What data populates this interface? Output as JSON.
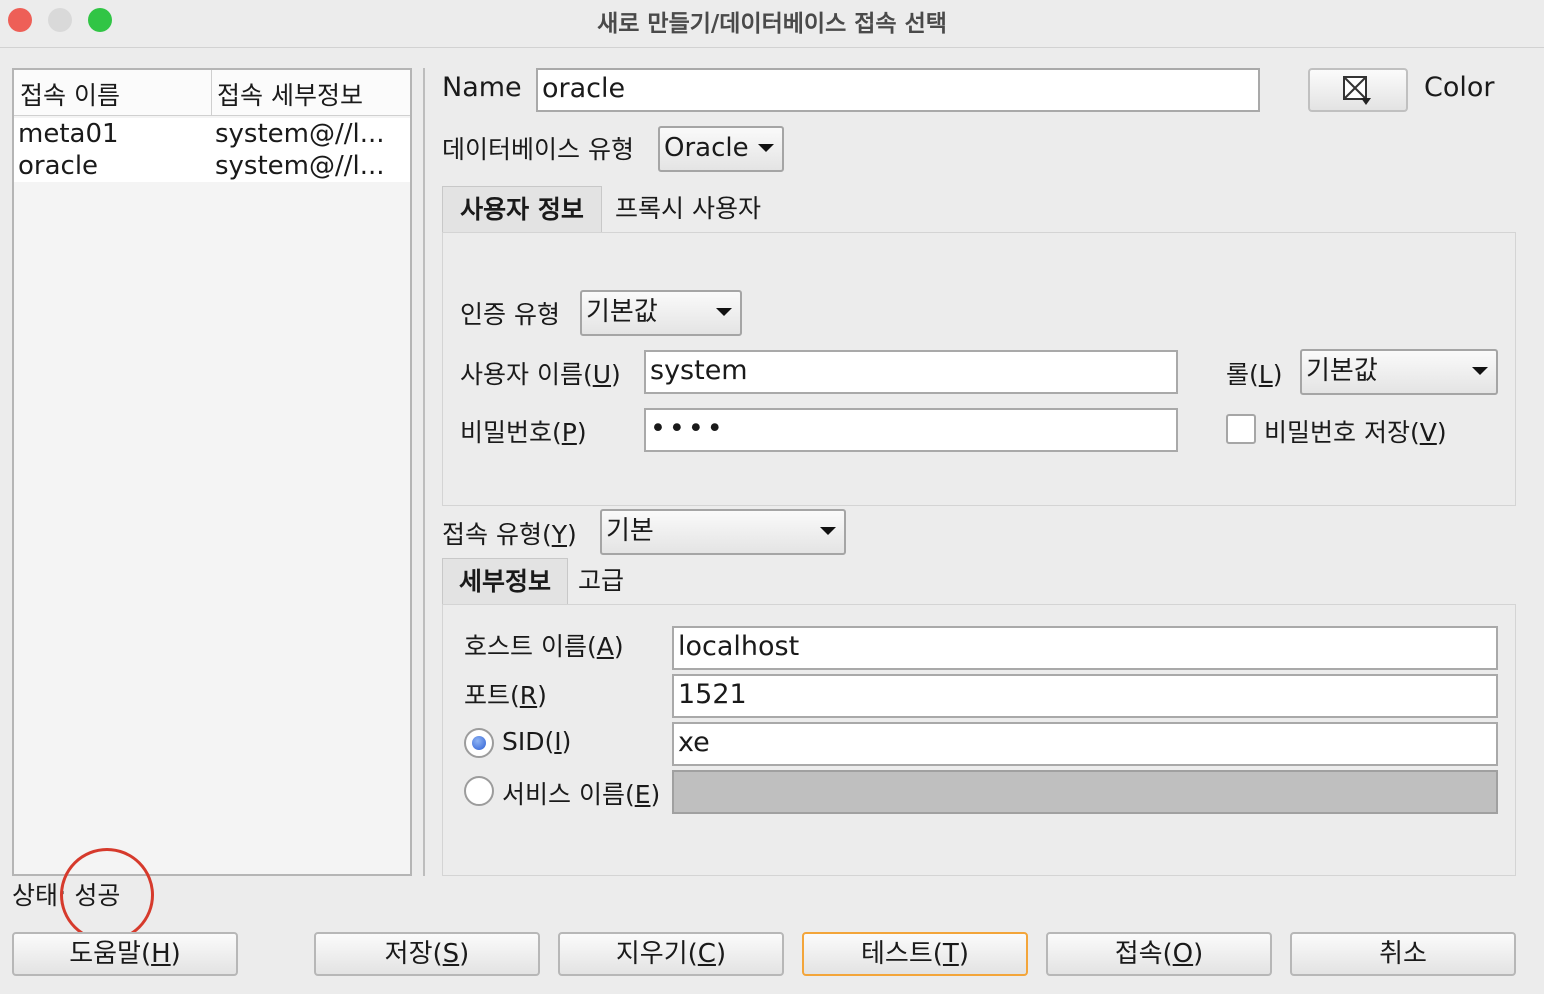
{
  "window": {
    "title": "새로 만들기/데이터베이스 접속 선택",
    "traffic_colors": {
      "close": "#ee5f57",
      "minimize": "#d9d9d9",
      "maximize": "#31c545"
    }
  },
  "connection_list": {
    "headers": [
      "접속 이름",
      "접속 세부정보"
    ],
    "rows": [
      {
        "name": "meta01",
        "details": "system@//l..."
      },
      {
        "name": "oracle",
        "details": "system@//l..."
      }
    ]
  },
  "form": {
    "name_label": "Name",
    "name_value": "oracle",
    "color_label": "Color",
    "db_type_label": "데이터베이스 유형",
    "db_type_value": "Oracle"
  },
  "user_tabs": [
    "사용자 정보",
    "프록시 사용자"
  ],
  "user_info": {
    "auth_type_label": "인증 유형",
    "auth_type_value": "기본값",
    "username_label": "사용자 이름(",
    "username_mnemonic": "U",
    "username_value": "system",
    "role_label": "롤(",
    "role_mnemonic": "L",
    "role_value": "기본값",
    "password_label": "비밀번호(",
    "password_mnemonic": "P",
    "password_value": "••••",
    "save_password_label": "비밀번호 저장(",
    "save_password_mnemonic": "V",
    "save_password_checked": false
  },
  "connection_type": {
    "label": "접속 유형(",
    "mnemonic": "Y",
    "value": "기본"
  },
  "detail_tabs": [
    "세부정보",
    "고급"
  ],
  "details": {
    "host_label": "호스트 이름(",
    "host_mnemonic": "A",
    "host_value": "localhost",
    "port_label": "포트(",
    "port_mnemonic": "R",
    "port_value": "1521",
    "sid_label": "SID(",
    "sid_mnemonic": "I",
    "sid_value": "xe",
    "sid_selected": true,
    "service_label": "서비스 이름(",
    "service_mnemonic": "E",
    "service_value": ""
  },
  "status": {
    "text": "상태: 성공",
    "annotation_color": "#d63a2c"
  },
  "buttons": [
    {
      "label": "도움말(",
      "mnemonic": "H"
    },
    {
      "label": "저장(",
      "mnemonic": "S"
    },
    {
      "label": "지우기(",
      "mnemonic": "C"
    },
    {
      "label": "테스트(",
      "mnemonic": "T"
    },
    {
      "label": "접속(",
      "mnemonic": "O"
    },
    {
      "label": "취소",
      "mnemonic": ""
    }
  ],
  "close_paren": ")"
}
